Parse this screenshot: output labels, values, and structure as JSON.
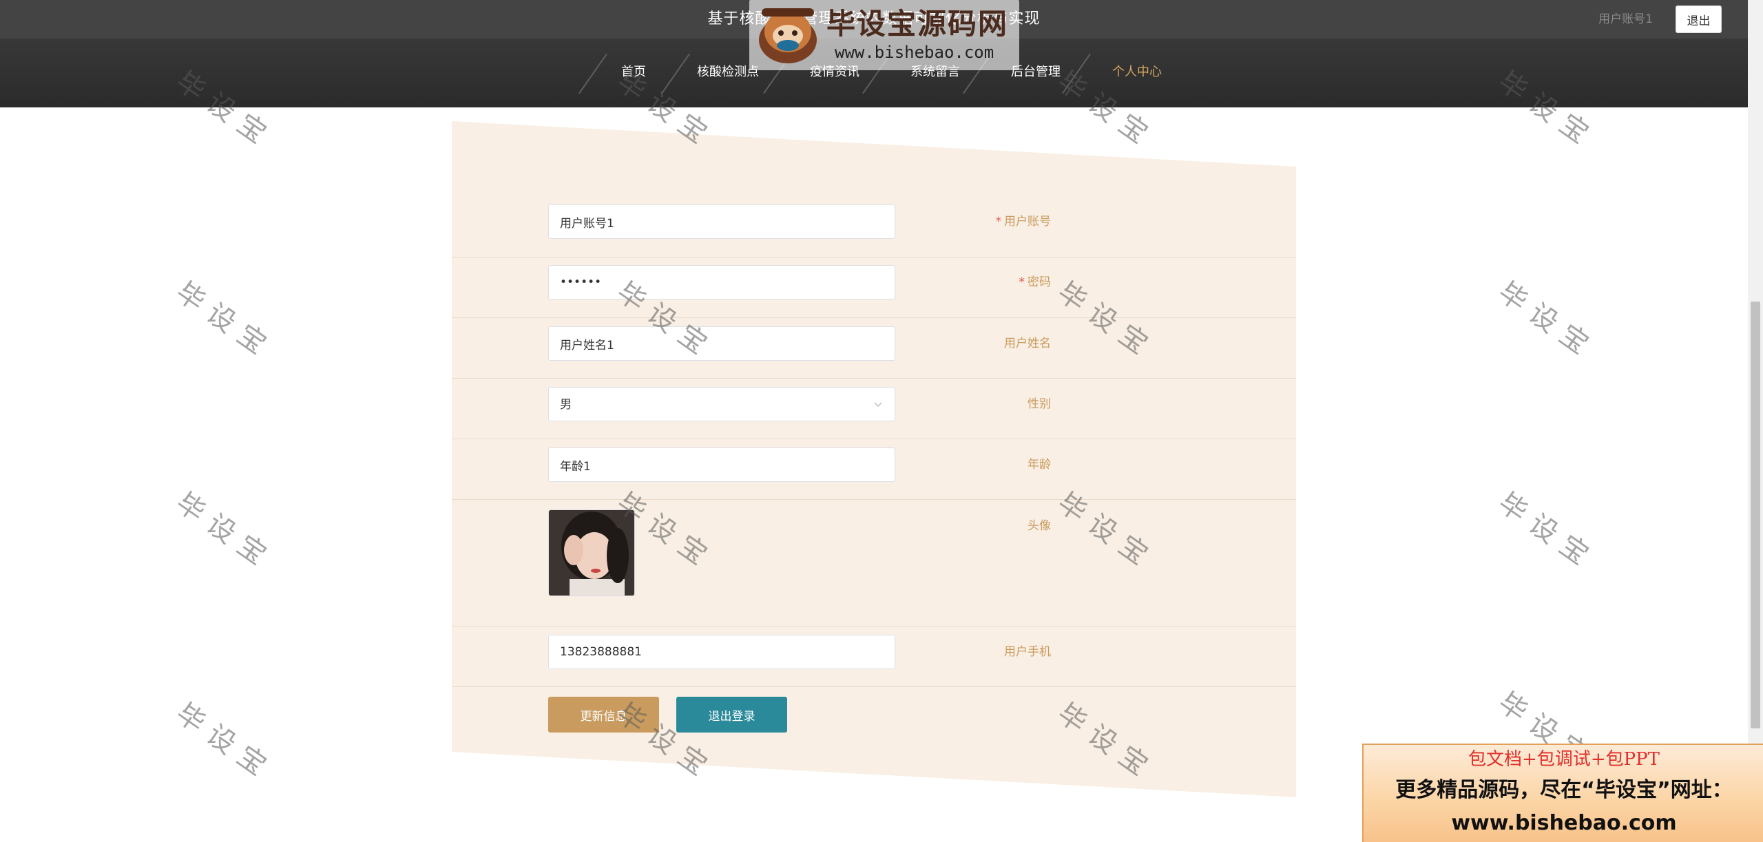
{
  "header": {
    "site_title": "基于核酸检测管理系统的数据可视化分析与实现",
    "user_name": "用户账号1",
    "logout_label": "退出"
  },
  "nav": {
    "items": [
      {
        "label": "首页"
      },
      {
        "label": "核酸检测点"
      },
      {
        "label": "疫情资讯"
      },
      {
        "label": "系统留言"
      },
      {
        "label": "后台管理"
      },
      {
        "label": "个人中心"
      }
    ],
    "active_index": 5
  },
  "form": {
    "account": {
      "label": "用户账号",
      "value": "用户账号1",
      "required": true
    },
    "password": {
      "label": "密码",
      "value": "123456",
      "required": true
    },
    "name": {
      "label": "用户姓名",
      "value": "用户姓名1"
    },
    "gender": {
      "label": "性别",
      "value": "男"
    },
    "age": {
      "label": "年龄",
      "value": "年龄1"
    },
    "avatar": {
      "label": "头像"
    },
    "phone": {
      "label": "用户手机",
      "value": "13823888881"
    },
    "required_mark": "*",
    "buttons": {
      "update": "更新信息",
      "logout": "退出登录"
    }
  },
  "watermark": {
    "logo_title": "毕设宝源码网",
    "logo_url": "www.bishebao.com",
    "text": "毕设宝"
  },
  "ad": {
    "line1": "包文档+包调试+包PPT",
    "line2": "更多精品源码，尽在“毕设宝”网址：",
    "line3": "www.bishebao.com"
  },
  "colors": {
    "header_bg": "#444444",
    "nav_active": "#d6a760",
    "panel_bg": "#f9efe4",
    "label": "#c99b5e",
    "update_button": "#c99b5e",
    "logout_button": "#2a8a9a"
  }
}
